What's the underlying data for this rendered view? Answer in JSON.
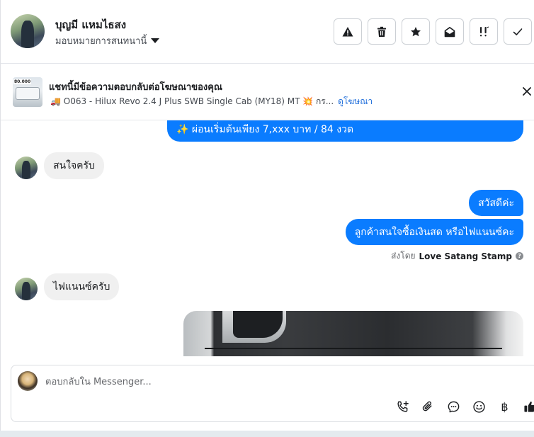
{
  "header": {
    "contact_name": "บุญมี แหมไธสง",
    "assign_label": "มอบหมายการสนทนานี้",
    "actions": [
      {
        "name": "report-button",
        "icon": "warning-icon"
      },
      {
        "name": "delete-button",
        "icon": "trash-icon"
      },
      {
        "name": "star-button",
        "icon": "star-icon"
      },
      {
        "name": "mark-unread-button",
        "icon": "envelope-open-icon"
      },
      {
        "name": "follow-up-button",
        "icon": "follow-up-icon"
      },
      {
        "name": "mark-done-button",
        "icon": "check-icon"
      }
    ]
  },
  "ad_banner": {
    "title": "แชทนี้มีข้อความตอบกลับต่อโฆษณาของคุณ",
    "thumb_tag": "80.000",
    "description": "🚚 O063 - Hilux Revo 2.4 J Plus SWB Single Cab (MY18) MT 💥 กร...",
    "link": "ดูโฆษณา"
  },
  "messages": {
    "promo": "✨ ผ่อนเริ่มต้นเพียง 7,xxx บาท / 84 งวด",
    "in_1": "สนใจครับ",
    "out_1": "สวัสดีค่ะ",
    "out_2": "ลูกค้าสนใจซื้อเงินสด หรือไฟแนนซ์คะ",
    "sent_by_prefix": "ส่งโดย",
    "sent_by_name": "Love Satang Stamp",
    "in_2": "ไฟแนนซ์ครับ"
  },
  "composer": {
    "placeholder": "ตอบกลับใน Messenger...",
    "tools": [
      "add-call-icon",
      "paperclip-icon",
      "chat-bubble-icon",
      "emoji-icon",
      "baht-icon",
      "thumbs-up-icon"
    ],
    "baht_glyph": "฿"
  },
  "colors": {
    "outgoing_bubble": "#0a7cff",
    "incoming_bubble": "#f0f0f0",
    "link": "#216fdb"
  }
}
